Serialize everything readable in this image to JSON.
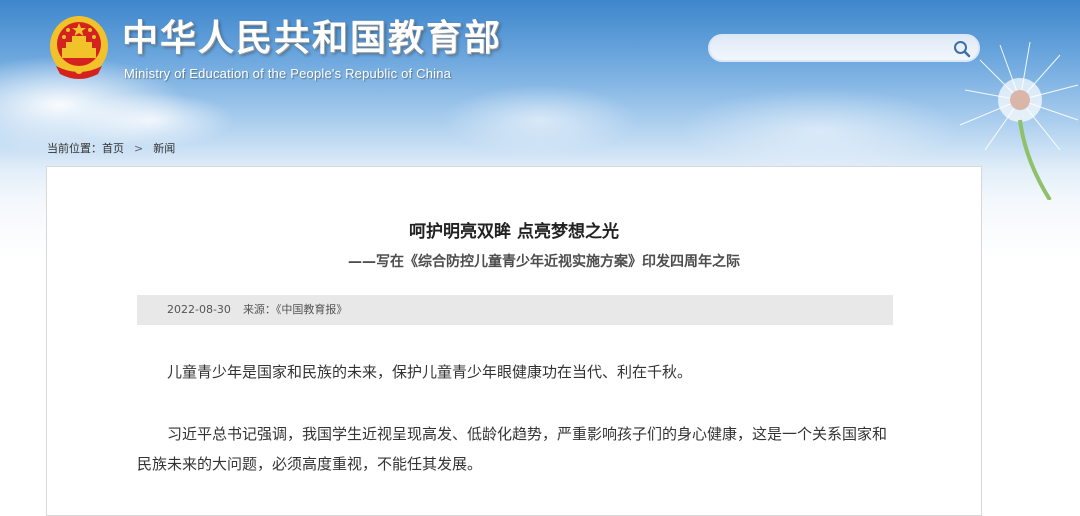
{
  "header": {
    "title": "中华人民共和国教育部",
    "subtitle": "Ministry of Education of the People's Republic of China",
    "emblem_icon": "national-emblem-icon"
  },
  "search": {
    "value": "",
    "placeholder": "",
    "icon": "search-icon"
  },
  "breadcrumb": {
    "label": "当前位置：",
    "items": [
      "首页",
      "新闻"
    ],
    "separator": ">"
  },
  "article": {
    "title": "呵护明亮双眸 点亮梦想之光",
    "subtitle": "——写在《综合防控儿童青少年近视实施方案》印发四周年之际",
    "date": "2022-08-30",
    "source": "来源：《中国教育报》",
    "paragraphs": [
      "儿童青少年是国家和民族的未来，保护儿童青少年眼健康功在当代、利在千秋。",
      "习近平总书记强调，我国学生近视呈现高发、低龄化趋势，严重影响孩子们的身心健康，这是一个关系国家和民族未来的大问题，必须高度重视，不能任其发展。"
    ]
  },
  "colors": {
    "sky_top": "#3e86cc",
    "emblem_red": "#d4231f",
    "emblem_gold": "#f2c22b",
    "meta_bar": "#e8e8e8"
  }
}
